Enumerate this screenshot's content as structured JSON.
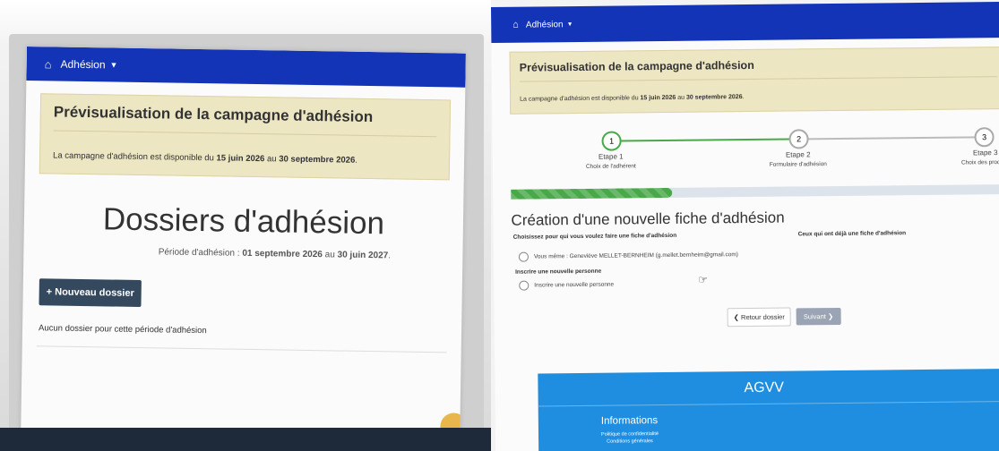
{
  "left": {
    "nav": {
      "home_icon": "home-icon",
      "menu_label": "Adhésion"
    },
    "preview": {
      "title": "Prévisualisation de la campagne d'adhésion",
      "text_prefix": "La campagne d'adhésion est disponible du",
      "date_start": "15 juin 2026",
      "text_mid": "au",
      "date_end": "30 septembre 2026",
      "text_suffix": "."
    },
    "main": {
      "title": "Dossiers d'adhésion",
      "period_prefix": "Période d'adhésion :",
      "period_start": "01 septembre 2026",
      "period_mid": "au",
      "period_end": "30 juin 2027",
      "period_suffix": ".",
      "new_button": "+ Nouveau dossier",
      "empty_text": "Aucun dossier pour cette période d'adhésion"
    }
  },
  "right": {
    "nav": {
      "home_icon": "home-icon",
      "menu_label": "Adhésion"
    },
    "preview": {
      "title": "Prévisualisation de la campagne d'adhésion",
      "text_prefix": "La campagne d'adhésion est disponible du",
      "date_start": "15 juin 2026",
      "text_mid": "au",
      "date_end": "30 septembre 2026",
      "text_suffix": "."
    },
    "steps": [
      {
        "number": "1",
        "label": "Etape 1",
        "sub": "Choix de l'adhérent"
      },
      {
        "number": "2",
        "label": "Etape 2",
        "sub": "Formulaire d'adhésion"
      },
      {
        "number": "3",
        "label": "Etape 3",
        "sub": "Choix des produits"
      }
    ],
    "progress_fraction": 0.33,
    "form": {
      "title": "Création d'une nouvelle fiche d'adhésion",
      "choose_label": "Choisissez pour qui vous voulez faire une fiche d'adhésion",
      "others_label": "Ceux qui ont déjà une fiche d'adhésion",
      "option_self": "Vous même : Geneviève MELLET-BERNHEIM (g.mellet.bernheim@gmail.com)",
      "new_person_heading": "Inscrire une nouvelle personne",
      "option_new": "Inscrire une nouvelle personne",
      "back_button": "Retour dossier",
      "next_button": "Suivant"
    },
    "footer": {
      "brand": "AGVV",
      "info_heading": "Informations",
      "link_privacy": "Politique de confidentialité",
      "link_terms": "Conditions générales"
    }
  },
  "colors": {
    "navbar": "#1434b8",
    "alert_bg": "#ede6c3",
    "primary_dark": "#34495e",
    "step_active": "#49a949",
    "footer_bg": "#1f8ee0"
  }
}
